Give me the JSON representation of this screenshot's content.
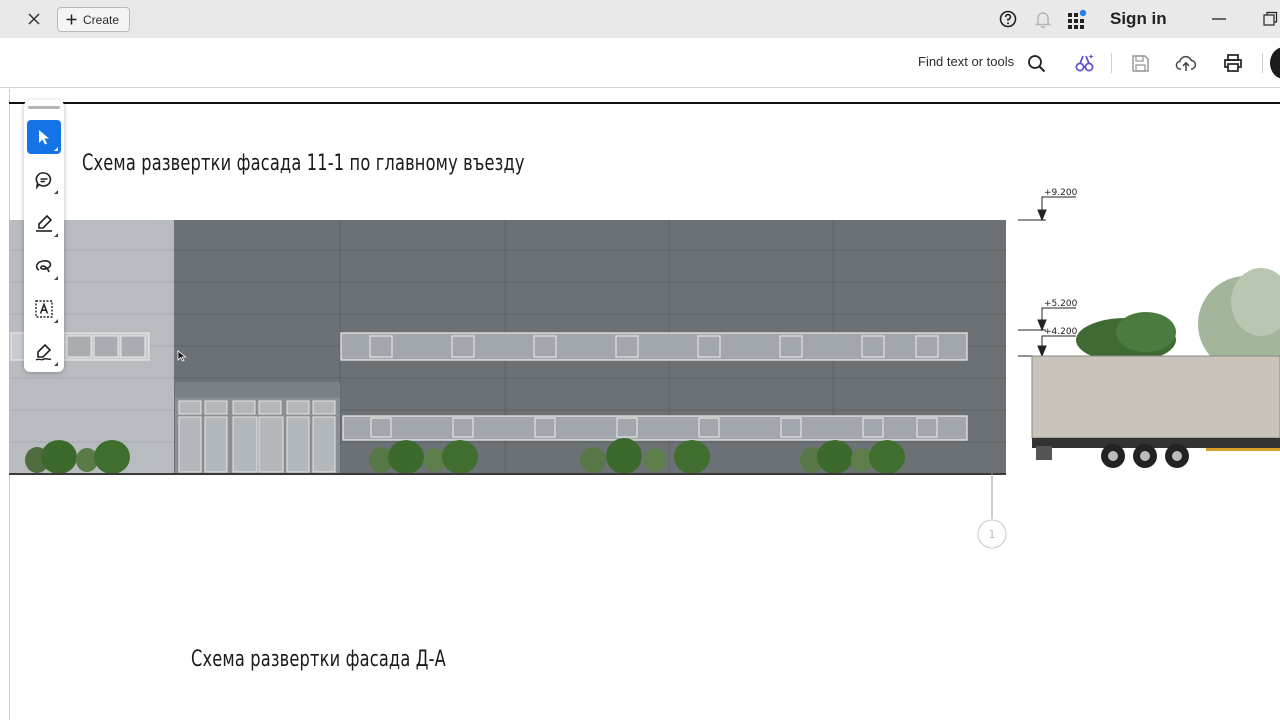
{
  "tabbar": {
    "create_label": "Create",
    "sign_in_label": "Sign in"
  },
  "toolbar": {
    "find_label": "Find text or tools"
  },
  "document": {
    "heading_1": "Схема развертки фасада 11-1 по главному въезду",
    "heading_2": "Схема развертки фасада Д-А",
    "elevations": [
      "+9.200",
      "+5.200",
      "+4.200"
    ],
    "axis_marker": "1"
  },
  "annotation_tools": [
    {
      "name": "select-tool",
      "icon": "arrow-cursor-icon"
    },
    {
      "name": "comment-tool",
      "icon": "comment-bubble-icon"
    },
    {
      "name": "highlight-tool",
      "icon": "marker-pen-icon"
    },
    {
      "name": "draw-tool",
      "icon": "freeform-loop-icon"
    },
    {
      "name": "text-box-tool",
      "icon": "text-box-icon"
    },
    {
      "name": "sign-tool",
      "icon": "signature-pen-icon"
    }
  ],
  "colors": {
    "accent": "#1473e6",
    "apps_blue": "#2680eb",
    "facade_dark": "#6c7176",
    "facade_light": "#b8bcc0"
  }
}
